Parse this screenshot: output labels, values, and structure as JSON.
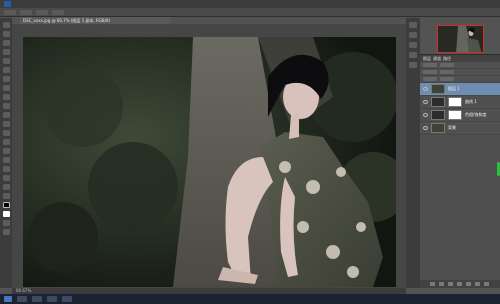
{
  "menubar": {
    "app_icon": "photoshop-logo",
    "menus": [
      "",
      "",
      "",
      "",
      "",
      "",
      "",
      "",
      "",
      "",
      ""
    ]
  },
  "document_tab": {
    "label": "DSC_xxxx.jpg @ 66.7% (图层 1 副本, RGB/8)"
  },
  "status_bar": {
    "zoom": "66.67%",
    "doc_info": ""
  },
  "layers_panel": {
    "tabs": [
      "图层",
      "通道",
      "路径"
    ],
    "layers": [
      {
        "name": "图层 1",
        "selected": true,
        "thumb": "photo"
      },
      {
        "name": "曲线 1",
        "selected": false,
        "thumb": "curve"
      },
      {
        "name": "色相/饱和度",
        "selected": false,
        "thumb": "white"
      },
      {
        "name": "背景",
        "selected": false,
        "thumb": "photo"
      }
    ]
  },
  "colors": {
    "accent": "#6f8db0",
    "navigator_frame": "#d42b2b",
    "marker_green": "#27c23a"
  }
}
